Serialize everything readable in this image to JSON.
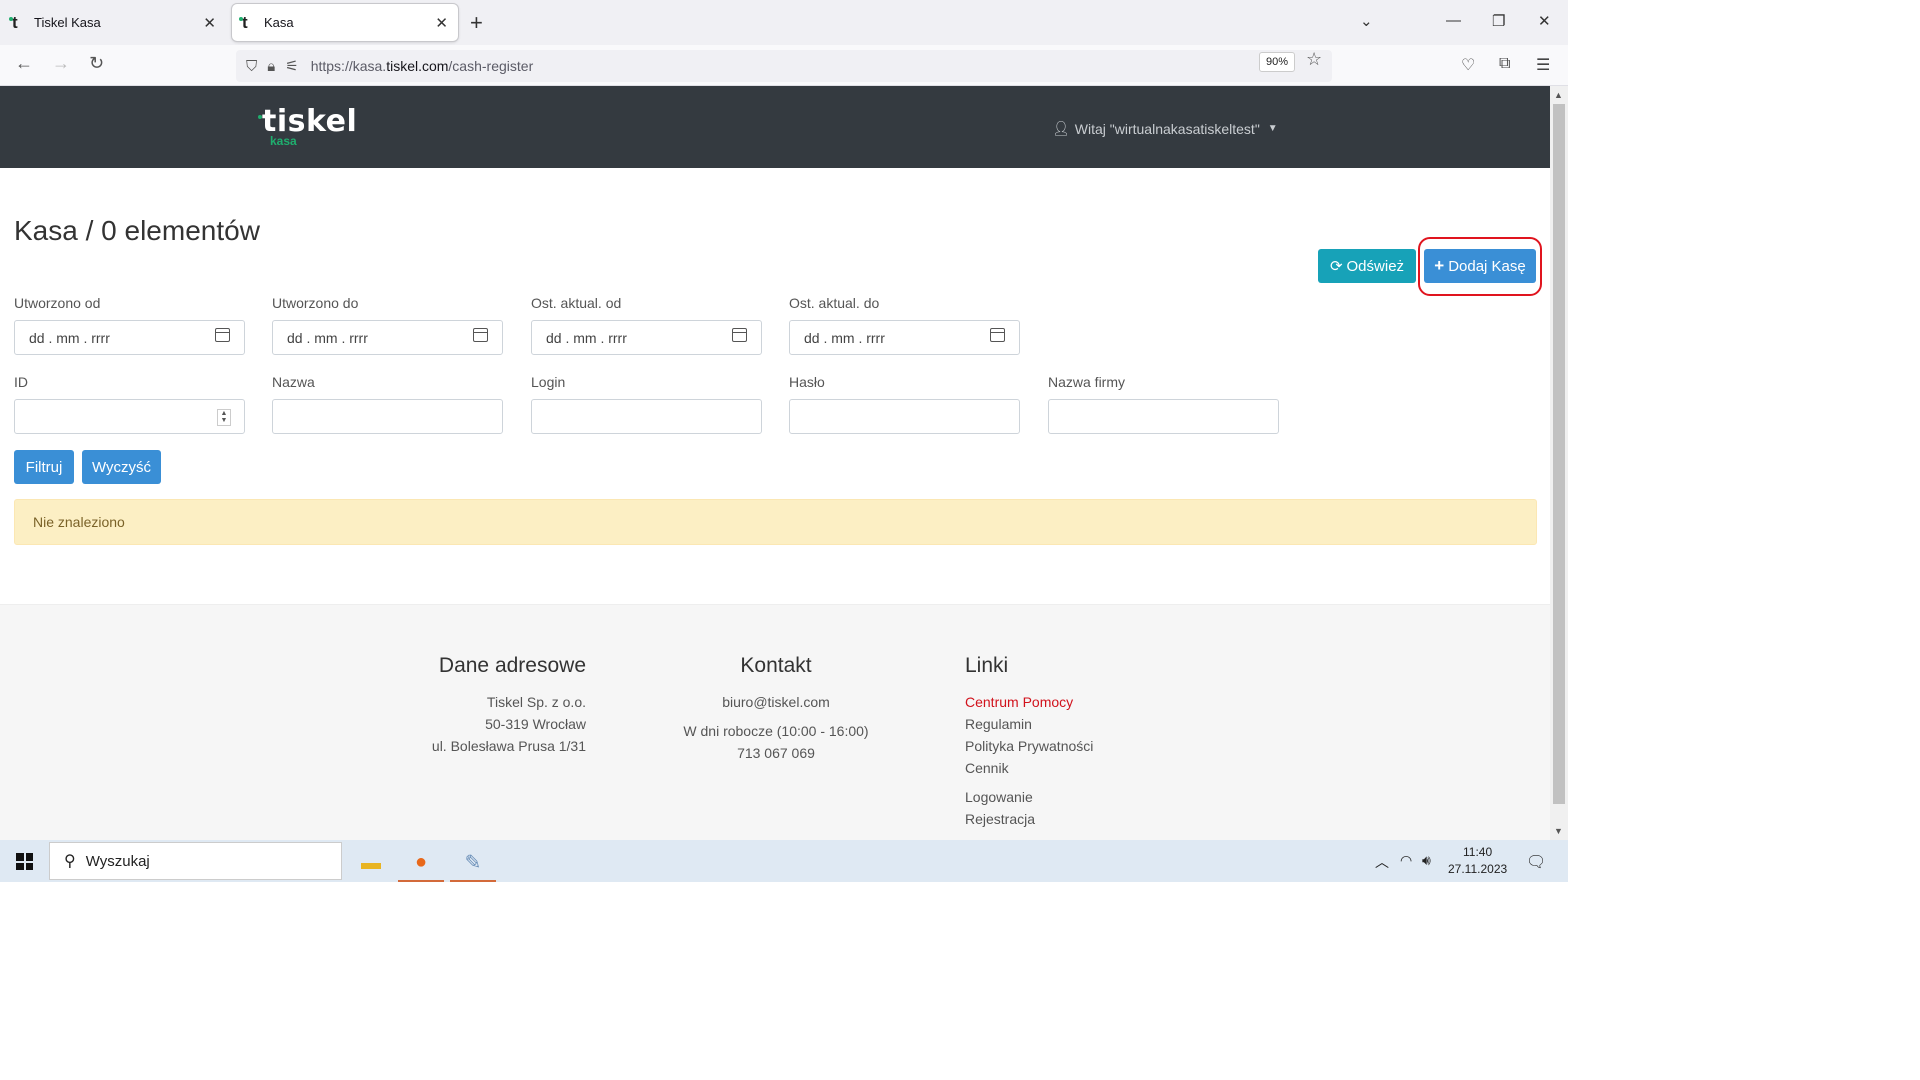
{
  "browser": {
    "tabs": [
      {
        "title": "Tiskel Kasa",
        "active": false
      },
      {
        "title": "Kasa",
        "active": true
      }
    ],
    "url_prefix": "https://kasa.",
    "url_domain": "tiskel.com",
    "url_path": "/cash-register",
    "zoom": "90%"
  },
  "app": {
    "logo_text": "tiskel",
    "logo_sub": "kasa",
    "user_greeting": "Witaj \"wirtualnakasatiskeltest\""
  },
  "page": {
    "title": "Kasa / 0 elementów",
    "refresh_label": "Odśwież",
    "add_label": "Dodaj Kasę"
  },
  "filters": {
    "created_from": {
      "label": "Utworzono od",
      "value": "dd . mm . rrrr"
    },
    "created_to": {
      "label": "Utworzono do",
      "value": "dd . mm . rrrr"
    },
    "updated_from": {
      "label": "Ost. aktual. od",
      "value": "dd . mm . rrrr"
    },
    "updated_to": {
      "label": "Ost. aktual. do",
      "value": "dd . mm . rrrr"
    },
    "id": {
      "label": "ID",
      "value": ""
    },
    "name": {
      "label": "Nazwa",
      "value": ""
    },
    "login": {
      "label": "Login",
      "value": ""
    },
    "password": {
      "label": "Hasło",
      "value": ""
    },
    "company": {
      "label": "Nazwa firmy",
      "value": ""
    },
    "filter_label": "Filtruj",
    "clear_label": "Wyczyść"
  },
  "alert": {
    "text": "Nie znaleziono"
  },
  "footer": {
    "address": {
      "title": "Dane adresowe",
      "lines": [
        "Tiskel Sp. z o.o.",
        "50-319 Wrocław",
        "ul. Bolesława Prusa 1/31"
      ]
    },
    "contact": {
      "title": "Kontakt",
      "email": "biuro@tiskel.com",
      "hours": "W dni robocze (10:00 - 16:00)",
      "phone": "713 067 069"
    },
    "links": {
      "title": "Linki",
      "items": [
        "Centrum Pomocy",
        "Regulamin",
        "Polityka Prywatności",
        "Cennik",
        "Logowanie",
        "Rejestracja"
      ]
    }
  },
  "taskbar": {
    "search_placeholder": "Wyszukaj",
    "time": "11:40",
    "date": "27.11.2023"
  },
  "colors": {
    "header_bg": "#343a40",
    "brand_green": "#1fae6e",
    "primary": "#3a8fd6",
    "info": "#17a2b8",
    "highlight_ring": "#e0141e"
  }
}
